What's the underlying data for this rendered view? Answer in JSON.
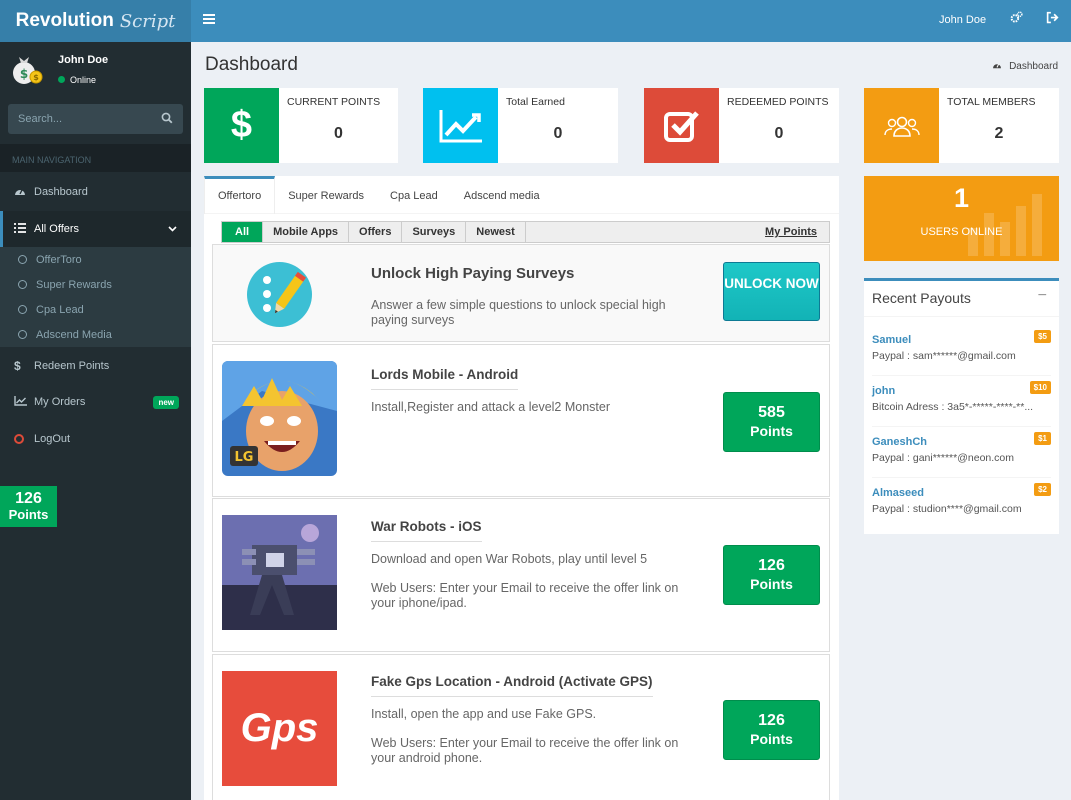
{
  "brand": {
    "bold": "Revolution",
    "italic": "Script"
  },
  "topbar": {
    "user": "John Doe"
  },
  "colors": {
    "green": "#00a65a",
    "aqua": "#00c0ef",
    "red": "#dd4b39",
    "orange": "#f39c12",
    "blue": "#3c8dbc"
  },
  "sidebar": {
    "user": {
      "name": "John Doe",
      "status": "Online"
    },
    "search_placeholder": "Search...",
    "nav_header": "MAIN NAVIGATION",
    "items": [
      {
        "label": "Dashboard",
        "icon": "dashboard-icon"
      },
      {
        "label": "All Offers",
        "icon": "list-icon"
      },
      {
        "label": "Redeem Points",
        "icon": "dollar-icon"
      },
      {
        "label": "My Orders",
        "icon": "line-chart-icon",
        "badge": "new"
      },
      {
        "label": "LogOut",
        "icon": "circle-icon"
      }
    ],
    "subitems": [
      "OfferToro",
      "Super Rewards",
      "Cpa Lead",
      "Adscend Media"
    ],
    "points": {
      "value": "126",
      "label": "Points"
    }
  },
  "page": {
    "title": "Dashboard",
    "breadcrumb": "Dashboard"
  },
  "stats": [
    {
      "label": "CURRENT POINTS",
      "value": "0",
      "icon": "dollar-icon"
    },
    {
      "label": "Total Earned",
      "value": "0",
      "icon": "chart-icon"
    },
    {
      "label": "REDEEMED POINTS",
      "value": "0",
      "icon": "check-square-icon"
    },
    {
      "label": "TOTAL MEMBERS",
      "value": "2",
      "icon": "users-icon"
    }
  ],
  "tabs": [
    "Offertoro",
    "Super Rewards",
    "Cpa Lead",
    "Adscend media"
  ],
  "filters": [
    "All",
    "Mobile Apps",
    "Offers",
    "Surveys",
    "Newest"
  ],
  "my_points": "My Points",
  "surveys": {
    "title": "Unlock High Paying Surveys",
    "desc": "Answer a few simple questions to unlock special high paying surveys",
    "btn": "UNLOCK NOW"
  },
  "offers": [
    {
      "title": "Lords Mobile - Android",
      "desc": "Install,Register and attack a level2 Monster",
      "desc2": "",
      "points": "585",
      "points_label": "Points"
    },
    {
      "title": "War Robots - iOS",
      "desc": "Download and open War Robots, play until level 5",
      "desc2": "Web Users: Enter your Email to receive the offer link on your iphone/ipad.",
      "points": "126",
      "points_label": "Points"
    },
    {
      "title": "Fake Gps Location - Android (Activate GPS)",
      "desc": "Install, open the app and use Fake GPS.",
      "desc2": "Web Users: Enter your Email to receive the offer link on your android phone.",
      "points": "126",
      "points_label": "Points",
      "thumb_text": "Gps"
    }
  ],
  "online": {
    "count": "1",
    "label": "USERS ONLINE"
  },
  "payouts": {
    "title": "Recent Payouts",
    "items": [
      {
        "name": "Samuel",
        "amount": "$5",
        "detail": "Paypal : sam******@gmail.com"
      },
      {
        "name": "john",
        "amount": "$10",
        "detail": "Bitcoin Adress : 3a5*-*****-****-**..."
      },
      {
        "name": "GaneshCh",
        "amount": "$1",
        "detail": "Paypal : gani******@neon.com"
      },
      {
        "name": "Almaseed",
        "amount": "$2",
        "detail": "Paypal : studion****@gmail.com"
      }
    ]
  }
}
